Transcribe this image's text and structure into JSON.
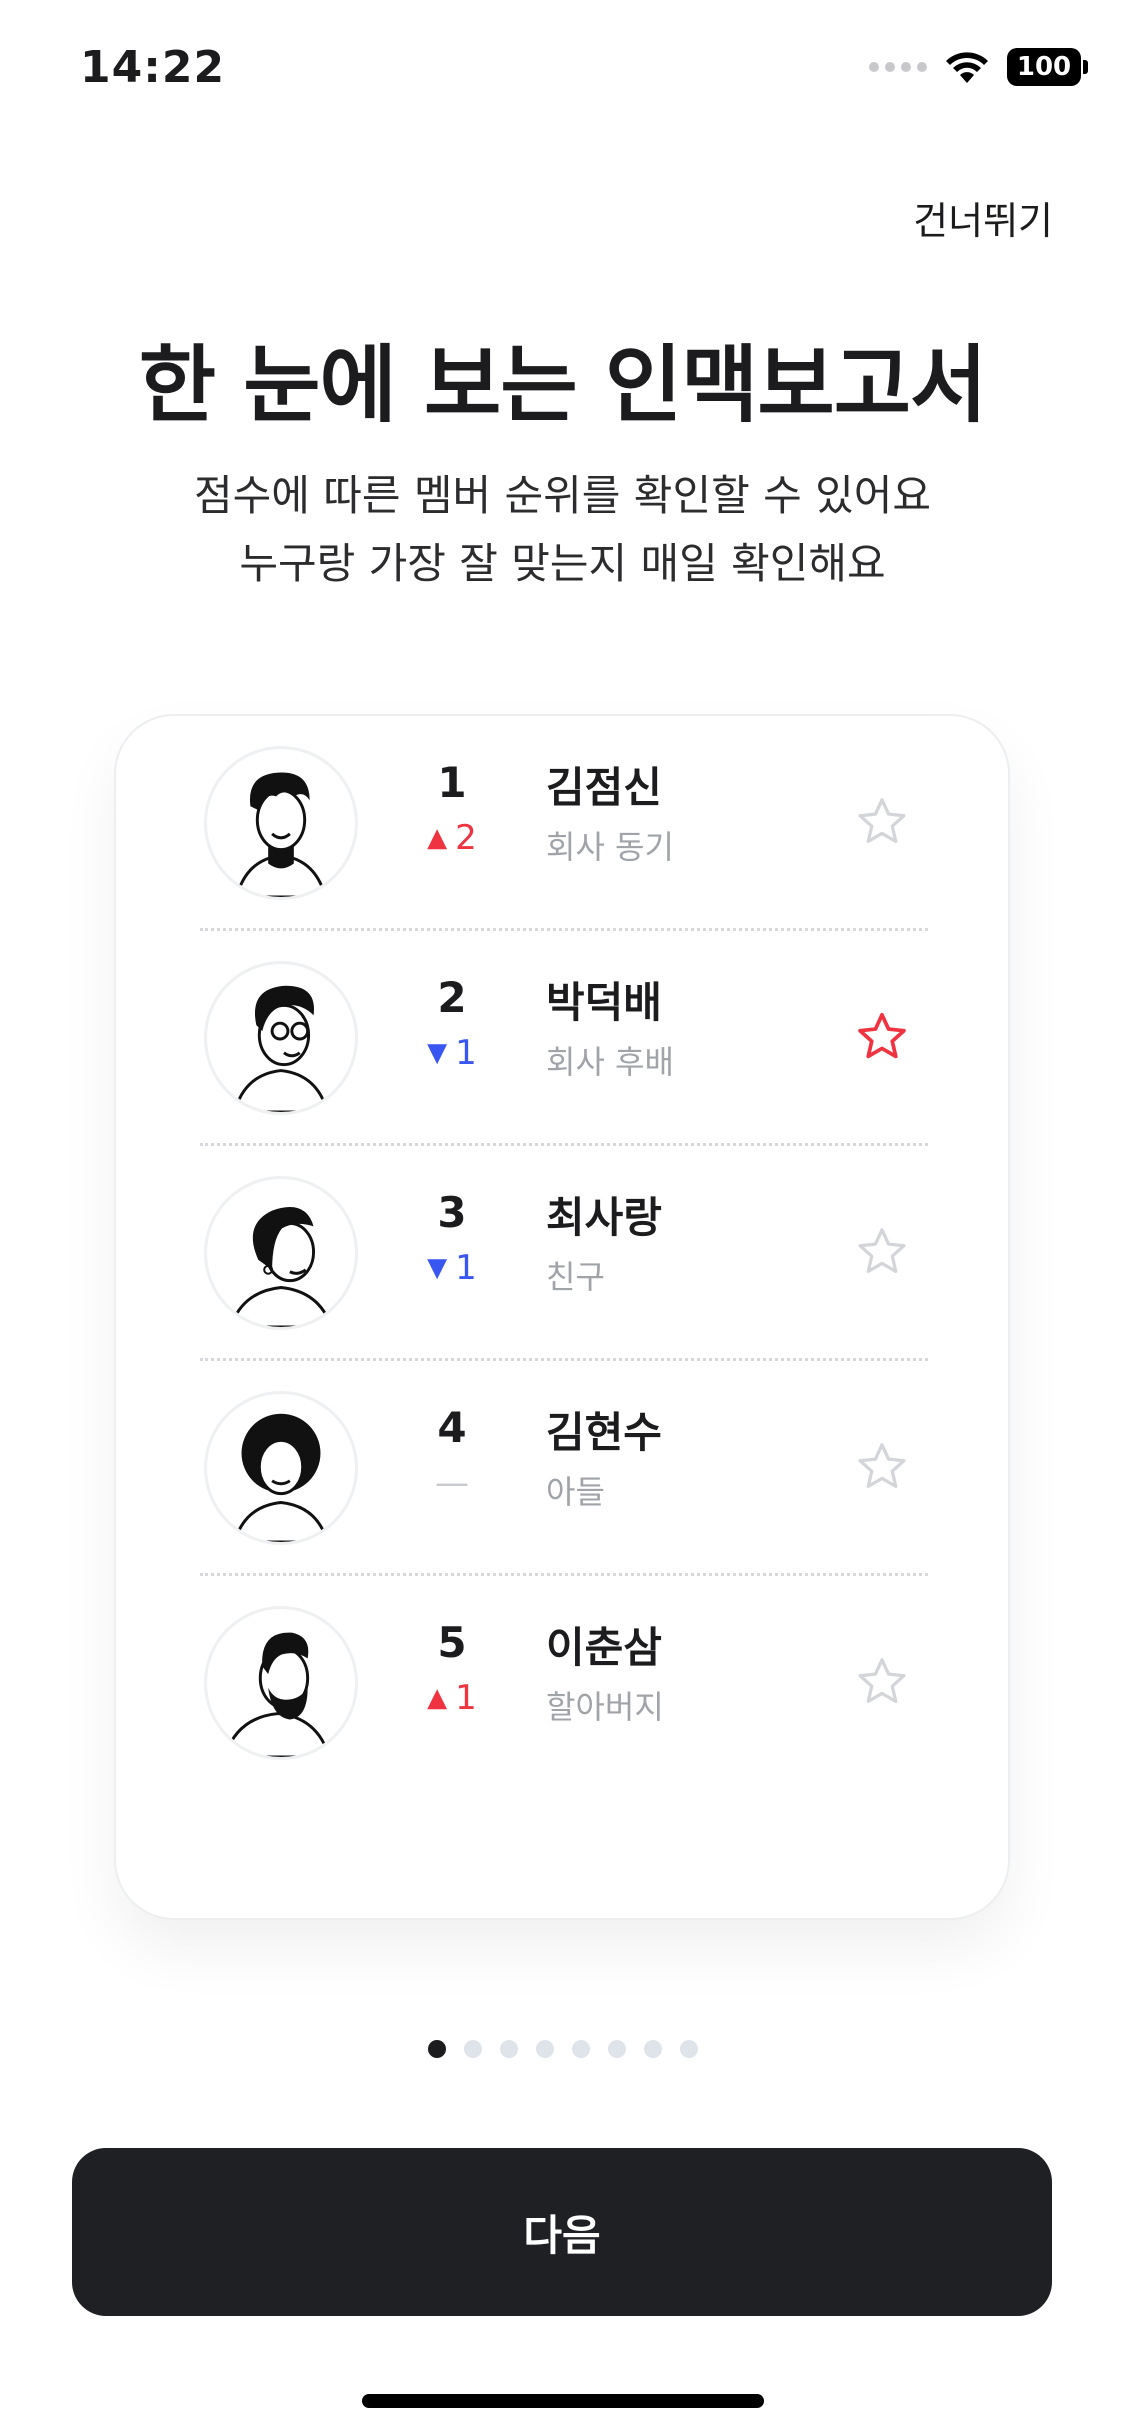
{
  "status_bar": {
    "time": "14:22",
    "battery": "100"
  },
  "header": {
    "skip_label": "건너뛰기"
  },
  "intro": {
    "title": "한 눈에 보는 인맥보고서",
    "subtitle_line1": "점수에 따른 멤버 순위를 확인할 수 있어요",
    "subtitle_line2": "누구랑 가장 잘 맞는지 매일 확인해요"
  },
  "ranking": [
    {
      "rank": "1",
      "change": "2",
      "trend": "up",
      "name": "김점신",
      "relation": "회사 동기",
      "favorite": false
    },
    {
      "rank": "2",
      "change": "1",
      "trend": "down",
      "name": "박덕배",
      "relation": "회사 후배",
      "favorite": true
    },
    {
      "rank": "3",
      "change": "1",
      "trend": "down",
      "name": "최사랑",
      "relation": "친구",
      "favorite": false
    },
    {
      "rank": "4",
      "change": "—",
      "trend": "same",
      "name": "김현수",
      "relation": "아들",
      "favorite": false
    },
    {
      "rank": "5",
      "change": "1",
      "trend": "up",
      "name": "이춘삼",
      "relation": "할아버지",
      "favorite": false
    }
  ],
  "pagination": {
    "total": 8,
    "current": 1
  },
  "footer": {
    "next_label": "다음"
  },
  "colors": {
    "up": "#ef3340",
    "down": "#3a56f0",
    "favorite": "#ef3340",
    "button": "#1f2023"
  }
}
